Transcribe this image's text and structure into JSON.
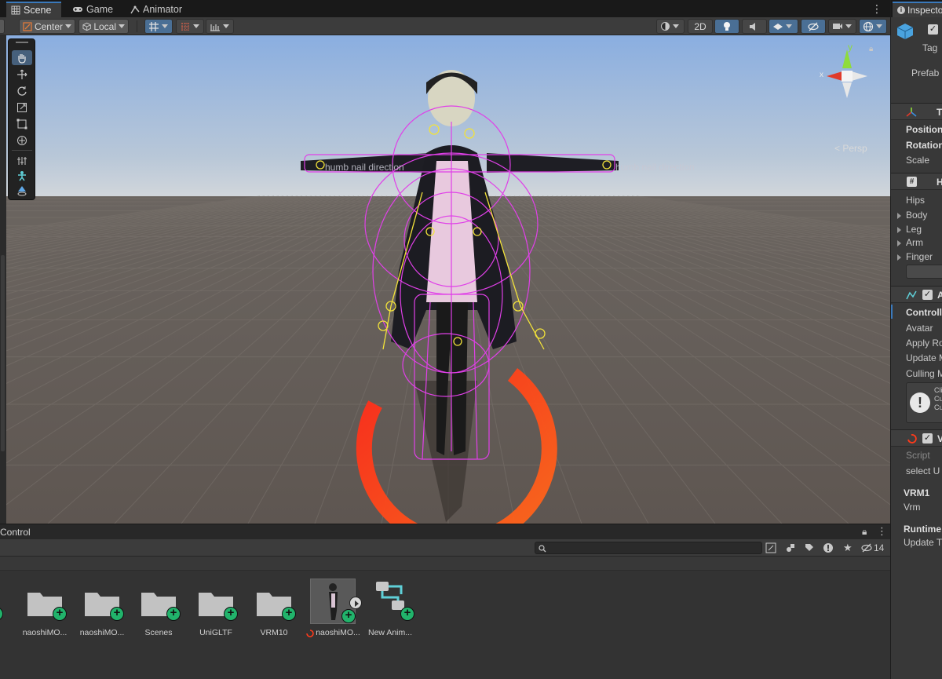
{
  "scene_tabs": [
    {
      "label": "Scene",
      "icon": "grid-icon",
      "active": true
    },
    {
      "label": "Game",
      "icon": "gamepad-icon",
      "active": false
    },
    {
      "label": "Animator",
      "icon": "animator-icon",
      "active": false
    }
  ],
  "toolbar": {
    "pivot": "Center",
    "space": "Local",
    "mode_2d": "2D"
  },
  "viewport": {
    "persp_label": "< Persp",
    "axis_x": "x",
    "axis_y": "y",
    "gizmo_label_left": "humb nail direction",
    "gizmo_label_right": "humb nail direction",
    "colors": {
      "sky": "#8fb0d8",
      "horizon": "#c9d1da",
      "ground": "#615a55",
      "rig": "#e040e8",
      "joint": "#f2e23a",
      "spinner": "#ff3a1a"
    }
  },
  "tool_palette": [
    "hand-tool-icon",
    "move-tool-icon",
    "rotate-tool-icon",
    "scale-tool-icon",
    "rect-tool-icon",
    "transform-tool-icon",
    "custom-tool-icon",
    "avatar-tool-icon",
    "visibility-tool-icon"
  ],
  "inspector": {
    "tab_label": "Inspector",
    "tag_label": "Tag",
    "prefab_label": "Prefab",
    "transform_title": "T",
    "transform_rows": [
      "Position",
      "Rotation",
      "Scale"
    ],
    "humanoid_title": "H",
    "humanoid_rows": [
      "Hips",
      "Body",
      "Leg",
      "Arm",
      "Finger"
    ],
    "animator_title": "A",
    "animator_rows": [
      "Controller",
      "Avatar",
      "Apply Ro",
      "Update M",
      "Culling M"
    ],
    "help_lines": [
      "Cli",
      "Cu",
      "Cu"
    ],
    "vrm_title": "V",
    "vrm_rows": [
      "Script",
      "select U"
    ],
    "vrm1_label": "VRM1",
    "vrm_label": "Vrm",
    "runtime_label": "Runtime",
    "update_label": "Update T"
  },
  "project": {
    "panel_title": "Control",
    "search_placeholder": "",
    "hidden_count": "14",
    "assets": [
      {
        "label": "naoshiMO...",
        "type": "folder"
      },
      {
        "label": "naoshiMO...",
        "type": "folder"
      },
      {
        "label": "Scenes",
        "type": "folder"
      },
      {
        "label": "UniGLTF",
        "type": "folder"
      },
      {
        "label": "VRM10",
        "type": "folder"
      },
      {
        "label": "naoshiMO...",
        "type": "model"
      },
      {
        "label": "New Anim...",
        "type": "animator-controller"
      }
    ]
  }
}
